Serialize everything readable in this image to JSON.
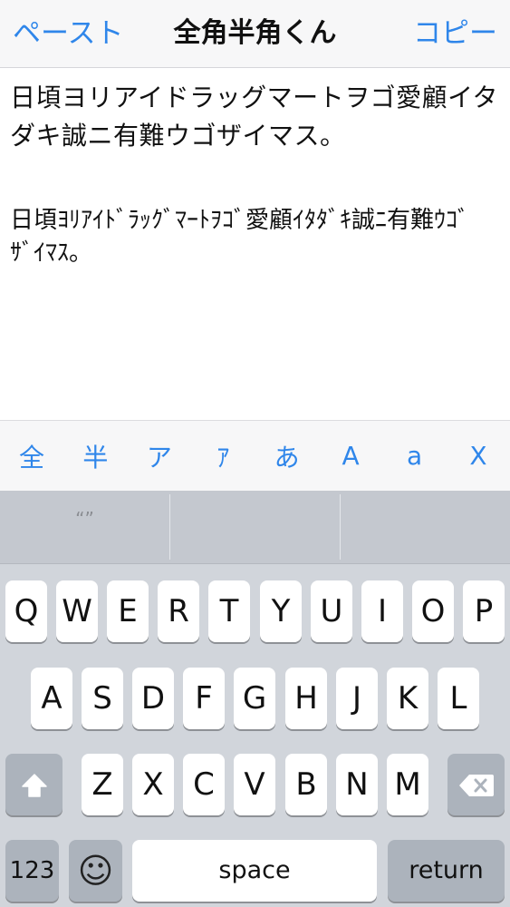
{
  "nav": {
    "left_label": "ペースト",
    "title": "全角半角くん",
    "right_label": "コピー"
  },
  "text": {
    "full_width": "日頃ヨリアイドラッグマートヲゴ愛顧イタダキ誠ニ有難ウゴザイマス。",
    "half_width": "日頃ﾖﾘｱｲﾄﾞﾗｯｸﾞﾏｰﾄｦｺﾞ愛顧ｲﾀﾀﾞｷ誠ﾆ有難ｳｺﾞｻﾞｲﾏｽ。"
  },
  "convert_bar": {
    "items": [
      "全",
      "半",
      "ア",
      "ｱ",
      "あ",
      "A",
      "a",
      "X"
    ]
  },
  "keyboard": {
    "suggestions": [
      "“”",
      "",
      ""
    ],
    "row1": [
      "Q",
      "W",
      "E",
      "R",
      "T",
      "Y",
      "U",
      "I",
      "O",
      "P"
    ],
    "row2": [
      "A",
      "S",
      "D",
      "F",
      "G",
      "H",
      "J",
      "K",
      "L"
    ],
    "row3": [
      "Z",
      "X",
      "C",
      "V",
      "B",
      "N",
      "M"
    ],
    "numbers_label": "123",
    "emoji_glyph": "☺",
    "space_label": "space",
    "return_label": "return",
    "shift_icon": "shift-arrow-icon",
    "delete_icon": "backspace-icon"
  },
  "colors": {
    "accent": "#2f86ea",
    "keyboard_bg": "#d1d5db",
    "function_key": "#acb3bc"
  }
}
